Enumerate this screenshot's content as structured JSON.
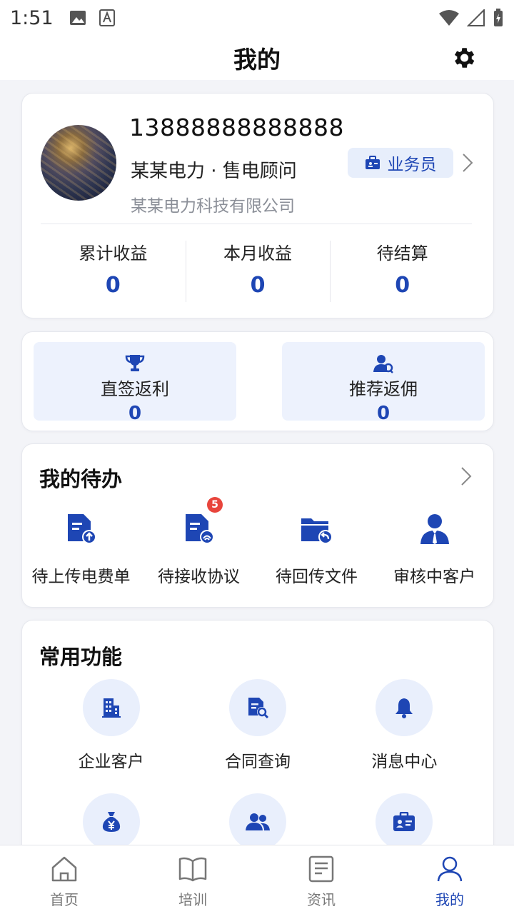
{
  "status_bar": {
    "time": "1:51"
  },
  "header": {
    "title": "我的"
  },
  "profile": {
    "phone": "13888888888888",
    "role_line": "某某电力 · 售电顾问",
    "company": "某某电力科技有限公司",
    "role_badge": "业务员"
  },
  "stats": [
    {
      "label": "累计收益",
      "value": "0"
    },
    {
      "label": "本月收益",
      "value": "0"
    },
    {
      "label": "待结算",
      "value": "0"
    }
  ],
  "rebates": [
    {
      "label": "直签返利",
      "value": "0",
      "icon": "trophy-icon"
    },
    {
      "label": "推荐返佣",
      "value": "0",
      "icon": "user-referral-icon"
    }
  ],
  "todo": {
    "title": "我的待办",
    "items": [
      {
        "label": "待上传电费单",
        "icon": "upload-document-icon"
      },
      {
        "label": "待接收协议",
        "icon": "document-signal-icon",
        "badge": "5"
      },
      {
        "label": "待回传文件",
        "icon": "folder-return-icon"
      },
      {
        "label": "审核中客户",
        "icon": "business-user-icon"
      }
    ]
  },
  "functions": {
    "title": "常用功能",
    "items": [
      {
        "label": "企业客户",
        "icon": "building-icon"
      },
      {
        "label": "合同查询",
        "icon": "contract-search-icon"
      },
      {
        "label": "消息中心",
        "icon": "bell-icon"
      },
      {
        "label": "",
        "icon": "money-bag-icon"
      },
      {
        "label": "",
        "icon": "team-icon"
      },
      {
        "label": "",
        "icon": "id-card-icon"
      }
    ]
  },
  "nav": [
    {
      "label": "首页",
      "icon": "home-icon"
    },
    {
      "label": "培训",
      "icon": "book-icon"
    },
    {
      "label": "资讯",
      "icon": "news-icon"
    },
    {
      "label": "我的",
      "icon": "profile-icon",
      "active": true
    }
  ],
  "colors": {
    "accent": "#1e46b4",
    "accent_light": "#e9effc",
    "badge": "#e8453c"
  }
}
